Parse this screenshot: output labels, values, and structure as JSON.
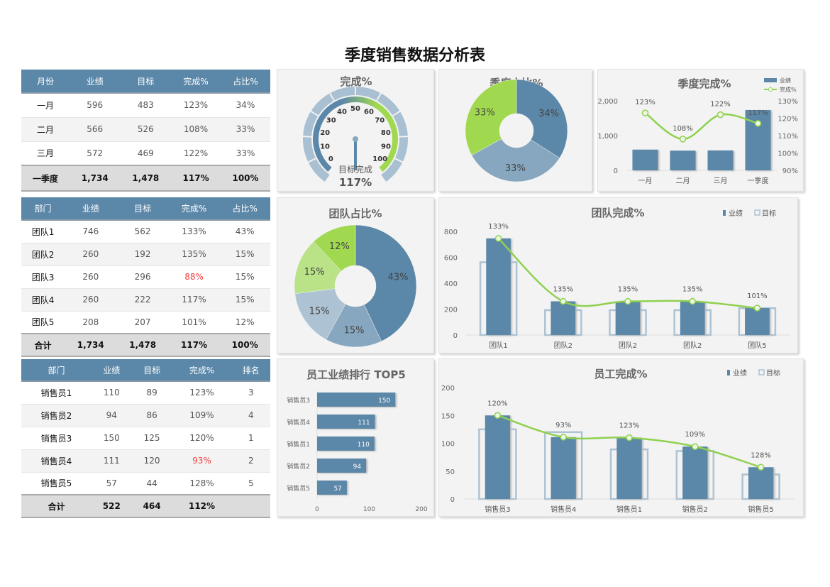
{
  "title": "季度销售数据分析表",
  "colors": {
    "header": "#5b87a8",
    "bar": "#5b87a8",
    "target": "#adc3d3",
    "line": "#8fd14f",
    "mid": "#86a7bf",
    "light": "#adc3d3",
    "green": "#a0d94f",
    "lightgreen": "#b9e386",
    "red": "#f04040"
  },
  "tables": [
    {
      "headers": [
        "月份",
        "业绩",
        "目标",
        "完成%",
        "占比%"
      ],
      "rows": [
        [
          "一月",
          "596",
          "483",
          "123%",
          "34%"
        ],
        [
          "二月",
          "566",
          "526",
          "108%",
          "33%"
        ],
        [
          "三月",
          "572",
          "469",
          "122%",
          "33%"
        ]
      ],
      "total": [
        "一季度",
        "1,734",
        "1,478",
        "117%",
        "100%"
      ]
    },
    {
      "headers": [
        "部门",
        "业绩",
        "目标",
        "完成%",
        "占比%"
      ],
      "rows": [
        [
          "团队1",
          "746",
          "562",
          "133%",
          "43%"
        ],
        [
          "团队2",
          "260",
          "192",
          "135%",
          "15%"
        ],
        [
          "团队3",
          "260",
          "296",
          "88%",
          "15%"
        ],
        [
          "团队4",
          "260",
          "222",
          "117%",
          "15%"
        ],
        [
          "团队5",
          "208",
          "207",
          "101%",
          "12%"
        ]
      ],
      "total": [
        "合计",
        "1,734",
        "1,478",
        "117%",
        "100%"
      ]
    },
    {
      "headers": [
        "部门",
        "业绩",
        "目标",
        "完成%",
        "排名"
      ],
      "rows": [
        [
          "销售员1",
          "110",
          "89",
          "123%",
          "3"
        ],
        [
          "销售员2",
          "94",
          "86",
          "109%",
          "4"
        ],
        [
          "销售员3",
          "150",
          "125",
          "120%",
          "1"
        ],
        [
          "销售员4",
          "111",
          "120",
          "93%",
          "2"
        ],
        [
          "销售员5",
          "57",
          "44",
          "128%",
          "5"
        ]
      ],
      "total": [
        "合计",
        "522",
        "464",
        "112%",
        ""
      ]
    }
  ],
  "chart_data": [
    {
      "id": "gauge",
      "type": "gauge",
      "title": "完成%",
      "ticks": [
        0,
        10,
        20,
        30,
        40,
        50,
        60,
        70,
        80,
        90,
        100
      ],
      "caption": "目标完成",
      "value_label": "117%",
      "value": 117
    },
    {
      "id": "quarter_pie",
      "type": "pie",
      "title": "季度占比%",
      "labels": [
        "一月",
        "二月",
        "三月"
      ],
      "values": [
        34,
        33,
        33
      ],
      "value_labels": [
        "34%",
        "33%",
        "33%"
      ],
      "colors": [
        "#5b87a8",
        "#86a7bf",
        "#a0d94f"
      ],
      "donut": true
    },
    {
      "id": "quarter_combo",
      "type": "bar",
      "title": "季度完成%",
      "categories": [
        "一月",
        "二月",
        "三月",
        "一季度"
      ],
      "series": [
        {
          "name": "业绩",
          "type": "bar",
          "values": [
            596,
            566,
            572,
            1734
          ]
        },
        {
          "name": "完成%",
          "type": "line",
          "axis": "right",
          "values": [
            123,
            108,
            122,
            117
          ],
          "labels": [
            "123%",
            "108%",
            "122%",
            "117%"
          ]
        }
      ],
      "ylim": [
        0,
        2000
      ],
      "yticks": [
        "0",
        "1,000",
        "2,000"
      ],
      "ytick_values": [
        0,
        1000,
        2000
      ],
      "y2lim": [
        90,
        130
      ],
      "y2ticks": [
        "90%",
        "100%",
        "110%",
        "120%",
        "130%"
      ],
      "y2tick_values": [
        90,
        100,
        110,
        120,
        130
      ],
      "legend": "top-right"
    },
    {
      "id": "team_pie",
      "type": "pie",
      "title": "团队占比%",
      "labels": [
        "团队1",
        "团队2",
        "团队3",
        "团队4",
        "团队5"
      ],
      "values": [
        43,
        15,
        15,
        15,
        12
      ],
      "value_labels": [
        "43%",
        "15%",
        "15%",
        "15%",
        "12%"
      ],
      "colors": [
        "#5b87a8",
        "#86a7bf",
        "#adc3d3",
        "#b9e386",
        "#a0d94f"
      ],
      "donut": true
    },
    {
      "id": "team_combo",
      "type": "bar",
      "title": "团队完成%",
      "categories": [
        "团队1",
        "团队2",
        "团队2",
        "团队2",
        "团队5"
      ],
      "series": [
        {
          "name": "业绩",
          "type": "bar",
          "values": [
            746,
            260,
            260,
            260,
            208
          ]
        },
        {
          "name": "目标",
          "type": "bar-outline",
          "values": [
            562,
            192,
            192,
            192,
            207
          ]
        },
        {
          "name": "",
          "type": "line",
          "values": [
            746,
            260,
            260,
            260,
            208
          ],
          "labels": [
            "133%",
            "135%",
            "135%",
            "135%",
            "101%"
          ]
        }
      ],
      "ylim": [
        0,
        800
      ],
      "yticks": [
        "0",
        "200",
        "400",
        "600",
        "800"
      ],
      "ytick_values": [
        0,
        200,
        400,
        600,
        800
      ],
      "legend": "top-right"
    },
    {
      "id": "top5",
      "type": "bar",
      "orientation": "horizontal",
      "title": "员工业绩排行 TOP5",
      "categories": [
        "销售员3",
        "销售员4",
        "销售员1",
        "销售员2",
        "销售员5"
      ],
      "values": [
        150,
        111,
        110,
        94,
        57
      ],
      "xlim": [
        0,
        200
      ],
      "xticks": [
        "0",
        "100",
        "200"
      ],
      "xtick_values": [
        0,
        100,
        200
      ]
    },
    {
      "id": "staff_combo",
      "type": "bar",
      "title": "员工完成%",
      "categories": [
        "销售员3",
        "销售员4",
        "销售员1",
        "销售员2",
        "销售员5"
      ],
      "series": [
        {
          "name": "业绩",
          "type": "bar",
          "values": [
            150,
            111,
            110,
            94,
            57
          ]
        },
        {
          "name": "目标",
          "type": "bar-outline",
          "values": [
            125,
            120,
            89,
            86,
            44
          ]
        },
        {
          "name": "",
          "type": "line",
          "values": [
            150,
            111,
            110,
            94,
            57
          ],
          "labels": [
            "120%",
            "93%",
            "123%",
            "109%",
            "128%"
          ]
        }
      ],
      "ylim": [
        0,
        200
      ],
      "yticks": [
        "0",
        "50",
        "100",
        "150",
        "200"
      ],
      "ytick_values": [
        0,
        50,
        100,
        150,
        200
      ],
      "legend": "top-right"
    }
  ]
}
